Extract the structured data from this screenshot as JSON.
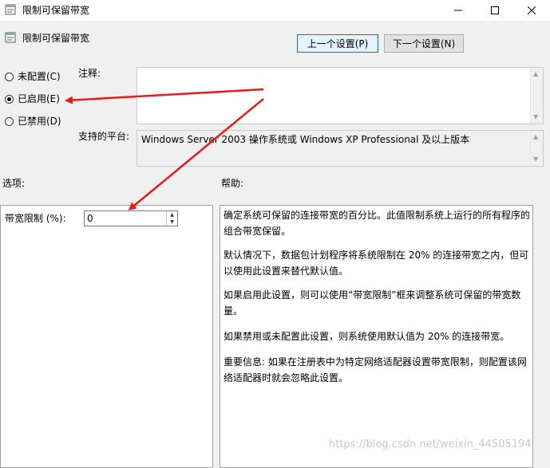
{
  "window": {
    "title": "限制可保留带宽",
    "minimize": "—",
    "maximize": "☐",
    "close": "✕"
  },
  "header": {
    "title": "限制可保留带宽",
    "prev_button": "上一个设置(P)",
    "next_button": "下一个设置(N)"
  },
  "state": {
    "options": [
      {
        "label": "未配置(C)",
        "selected": false
      },
      {
        "label": "已启用(E)",
        "selected": true
      },
      {
        "label": "已禁用(D)",
        "selected": false
      }
    ]
  },
  "comment": {
    "label": "注释:",
    "value": ""
  },
  "platform": {
    "label": "支持的平台:",
    "value": "Windows Server 2003 操作系统或 Windows XP Professional 及以上版本"
  },
  "options_section": {
    "label": "选项:",
    "bandwidth_label": "带宽限制 (%):",
    "bandwidth_value": "0"
  },
  "help_section": {
    "label": "帮助:",
    "paragraphs": [
      "确定系统可保留的连接带宽的百分比。此值限制系统上运行的所有程序的组合带宽保留。",
      "默认情况下，数据包计划程序将系统限制在 20% 的连接带宽之内，但可以使用此设置来替代默认值。",
      "如果启用此设置，则可以使用“带宽限制”框来调整系统可保留的带宽数量。",
      "如果禁用或未配置此设置，则系统使用默认值为 20% 的连接带宽。",
      "重要信息: 如果在注册表中为特定网络适配器设置带宽限制，则配置该网络适配器时就会忽略此设置。"
    ]
  },
  "watermark": "https://blog.csdn.net/weixin_44505194",
  "colors": {
    "annotation_arrow": "#e8191b",
    "button_focus_border": "#0078d7"
  }
}
